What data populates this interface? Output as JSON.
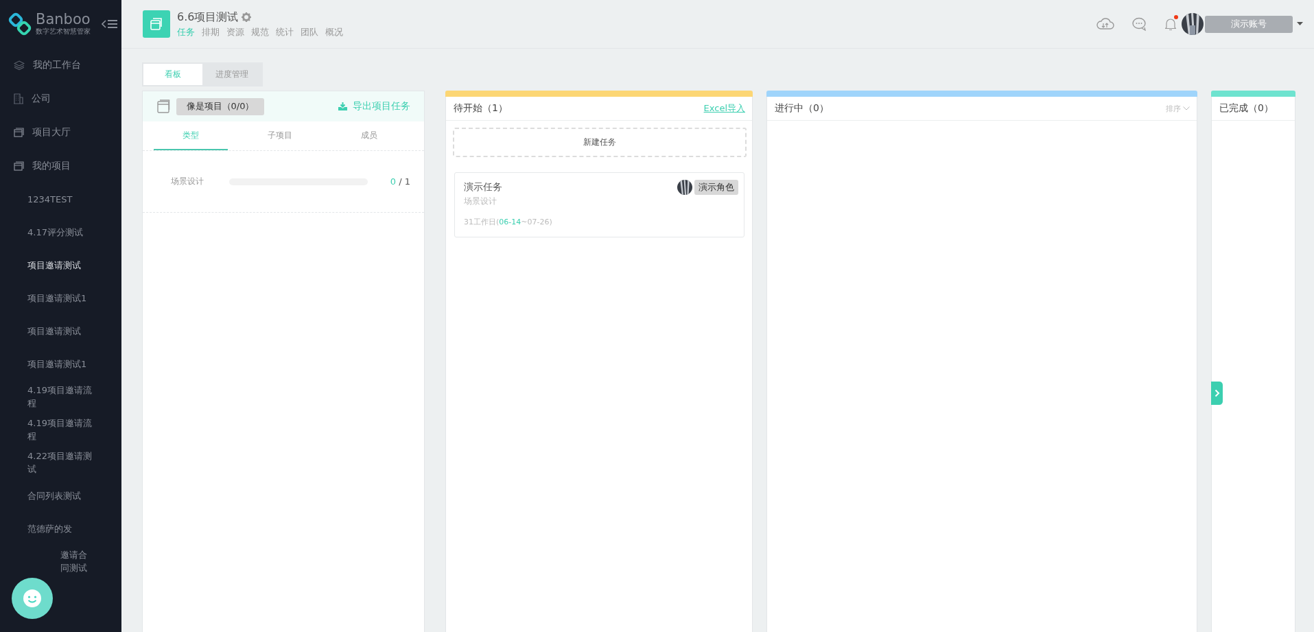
{
  "sidebar": {
    "logo": {
      "name": "Banboo",
      "tagline": "数字艺术智慧管家"
    },
    "nav": [
      {
        "label": "我的工作台"
      },
      {
        "label": "公司"
      },
      {
        "label": "项目大厅"
      },
      {
        "label": "我的项目"
      }
    ],
    "projects": [
      {
        "label": "1234TEST",
        "selected": false
      },
      {
        "label": "4.17评分测试",
        "selected": false
      },
      {
        "label": "项目邀请测试",
        "selected": true
      },
      {
        "label": "项目邀请测试1",
        "selected": false
      },
      {
        "label": "项目邀请测试",
        "selected": false
      },
      {
        "label": "项目邀请测试1",
        "selected": false
      },
      {
        "label": "4.19项目邀请流程",
        "selected": false
      },
      {
        "label": "4.19项目邀请流程",
        "selected": false
      },
      {
        "label": "4.22项目邀请测试",
        "selected": false
      },
      {
        "label": "合同列表测试",
        "selected": false
      },
      {
        "label": "范德萨的发",
        "selected": false
      },
      {
        "label": "邀请合同测试",
        "selected": false
      }
    ]
  },
  "header": {
    "project_title": "6.6项目测试",
    "nav": [
      {
        "label": "任务",
        "selected": true
      },
      {
        "label": "排期",
        "selected": false
      },
      {
        "label": "资源",
        "selected": false
      },
      {
        "label": "规范",
        "selected": false
      },
      {
        "label": "统计",
        "selected": false
      },
      {
        "label": "团队",
        "selected": false
      },
      {
        "label": "概况",
        "selected": false
      }
    ],
    "notifications": {
      "unread": true
    },
    "account": "演示账号"
  },
  "view_tabs": [
    {
      "label": "看板",
      "selected": true
    },
    {
      "label": "进度管理",
      "selected": false
    }
  ],
  "left_panel": {
    "project_button": "像是项目（0/0）",
    "export": "导出项目任务",
    "tabs": [
      {
        "label": "类型",
        "selected": true
      },
      {
        "label": "子项目",
        "selected": false
      },
      {
        "label": "成员",
        "selected": false
      }
    ],
    "rows": [
      {
        "name": "场景设计",
        "level": 0,
        "done": "0",
        "rest": "/ 1"
      }
    ]
  },
  "columns": [
    {
      "title": "待开始（1）",
      "color": "#fcd674",
      "action": "Excel导入",
      "new_task": "新建任务",
      "cards": [
        {
          "title": "演示任务",
          "type": "场景设计",
          "duration": "31工作日(",
          "start": "06-14",
          "end": "~07-26)",
          "role": "演示角色"
        }
      ]
    },
    {
      "title": "进行中（0）",
      "color": "#9fd4fb",
      "sort": "排序"
    },
    {
      "title": "已完成（0）",
      "color": "#6ee3cf"
    }
  ]
}
